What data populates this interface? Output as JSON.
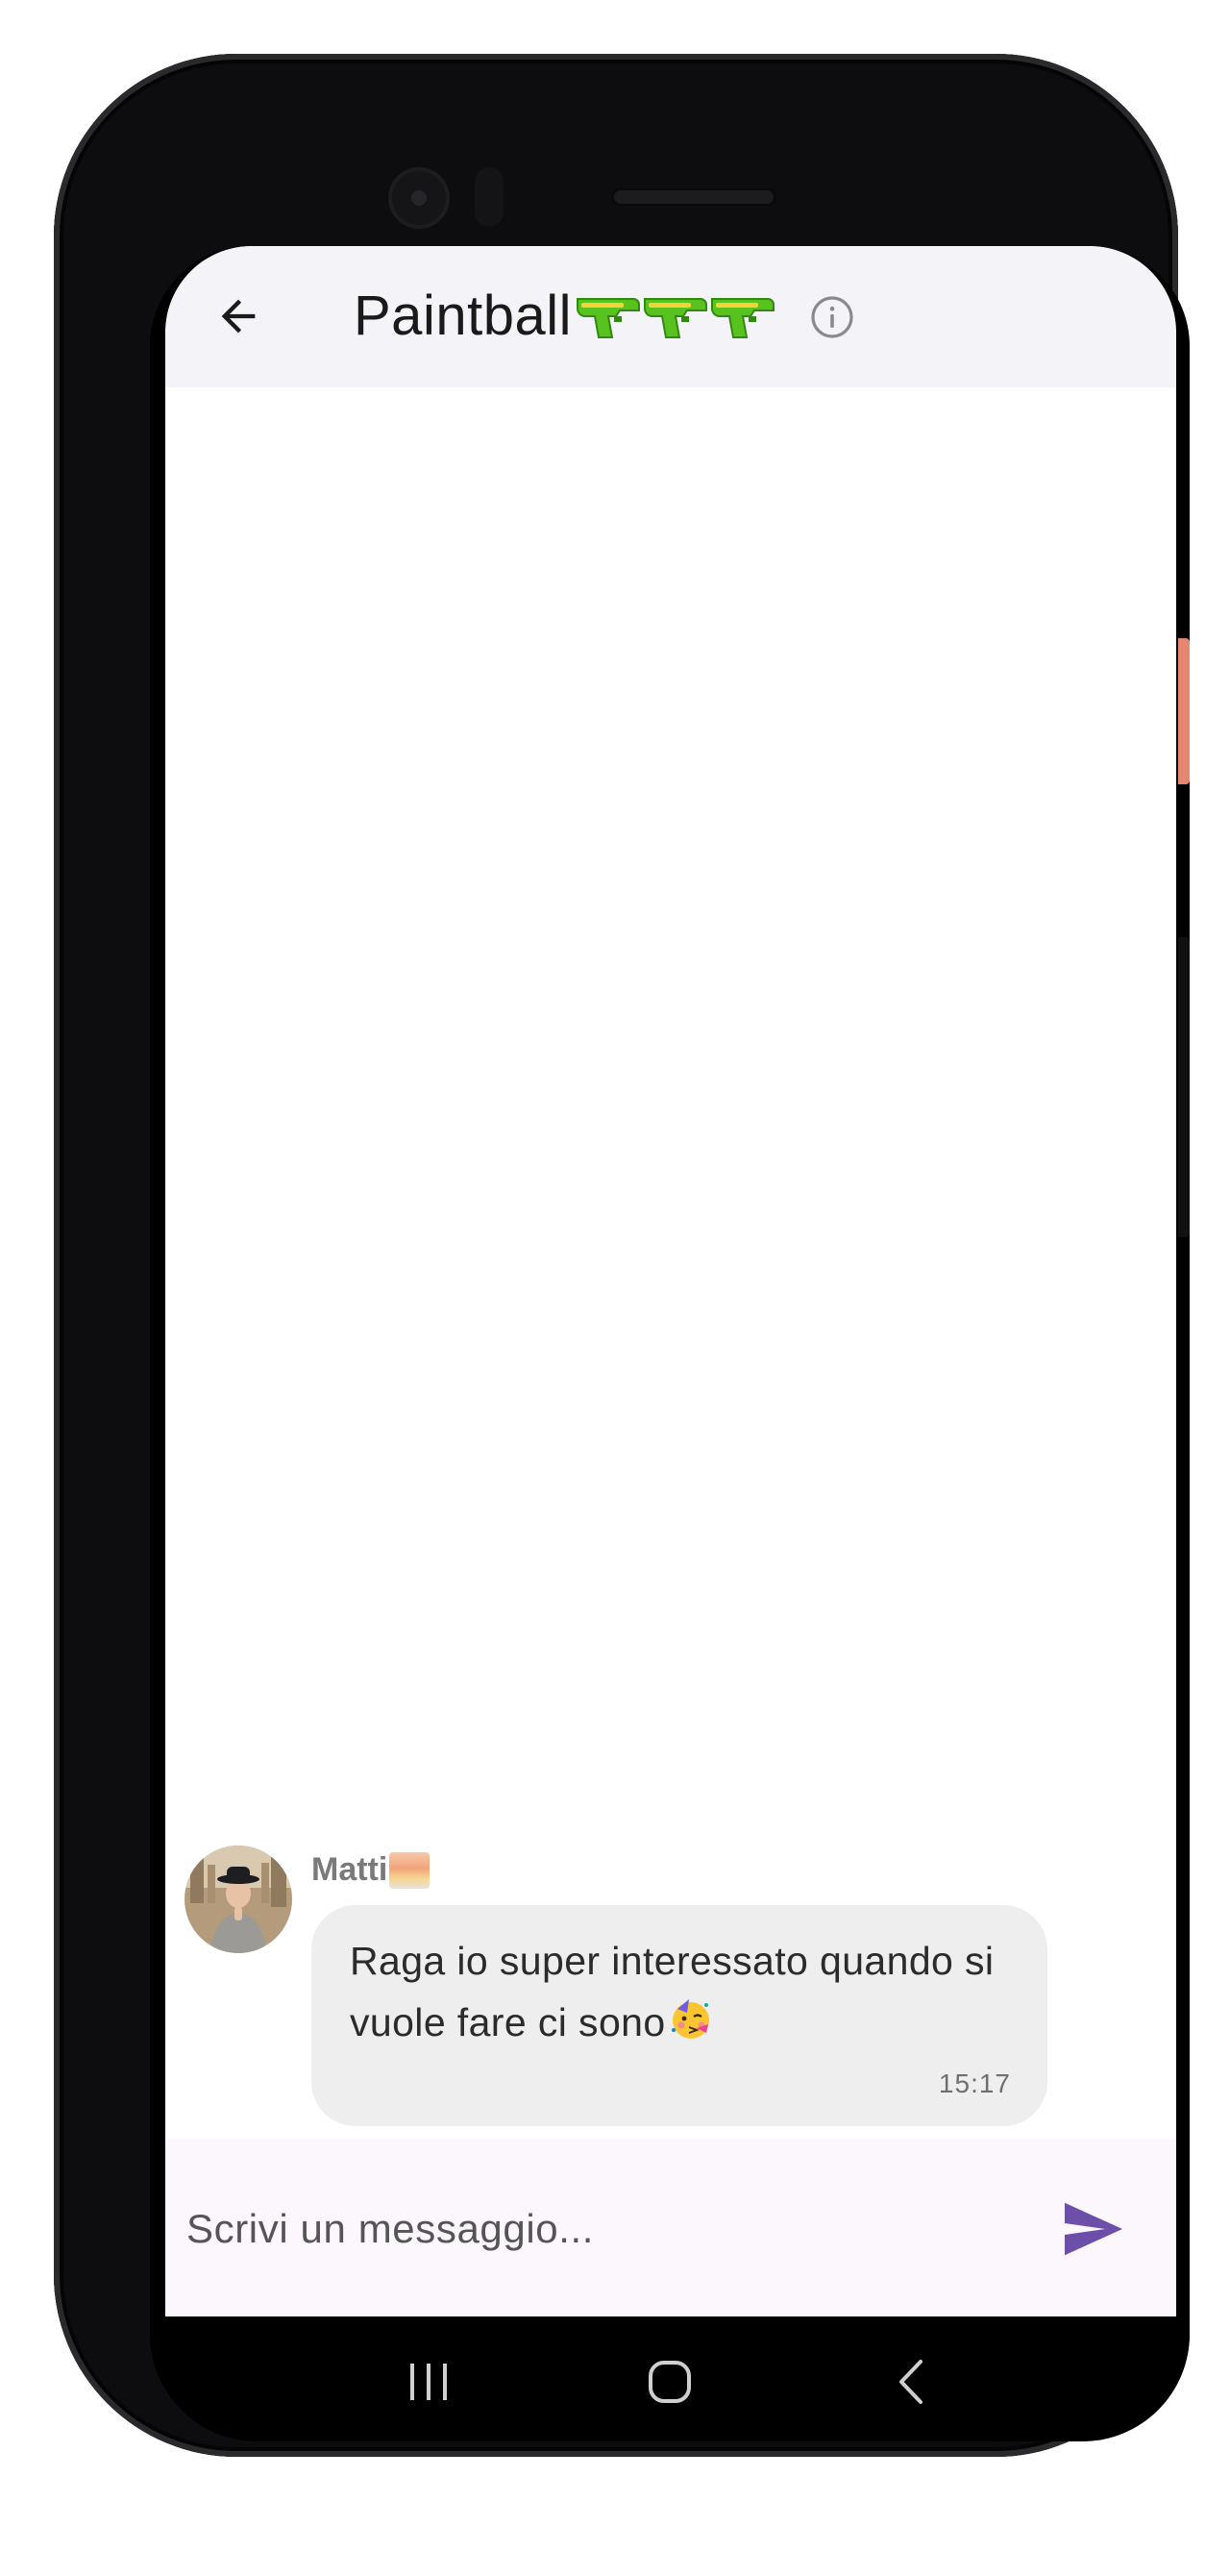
{
  "header": {
    "title": "Paintball",
    "emoji_icons": [
      "water-pistol-icon",
      "water-pistol-icon",
      "water-pistol-icon"
    ],
    "back_icon": "arrow-left-icon",
    "info_icon": "info-circle-icon"
  },
  "messages": [
    {
      "sender": "Matti",
      "sender_emoji_icon": "sunrise-emoji-icon",
      "text": "Raga io super interessato quando si vuole fare ci sono",
      "text_emoji_icon": "partying-face-emoji-icon",
      "time": "15:17"
    }
  ],
  "composer": {
    "placeholder": "Scrivi un messaggio...",
    "send_icon": "send-icon"
  },
  "navigation": {
    "recents_icon": "recents-icon",
    "home_icon": "home-icon",
    "back_icon": "chevron-left-icon"
  },
  "colors": {
    "accent": "#6b4fa8",
    "appbar_bg": "#f4f3f8",
    "bubble_bg": "#eeeeee",
    "composer_bg": "#fcf6fd"
  }
}
